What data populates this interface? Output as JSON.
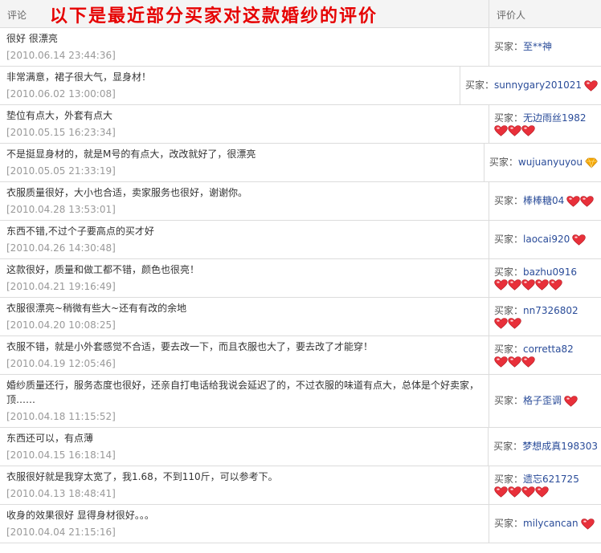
{
  "header": {
    "comment_label": "评论",
    "title": "以下是最近部分买家对这款婚纱的评价",
    "rater_label": "评价人"
  },
  "colors": {
    "title": "#e60000",
    "heart": "#e8303a",
    "diamond": "#f5a700",
    "name": "#2a4c99"
  },
  "reviews": [
    {
      "comment": "很好 很漂亮",
      "date": "[2010.06.14 23:44:36]",
      "buyer_prefix": "买家：",
      "buyer": "至**神",
      "badge": "none",
      "badge_count": 0
    },
    {
      "comment": "非常满意，裙子很大气，显身材！",
      "date": "[2010.06.02 13:00:08]",
      "buyer_prefix": "买家：",
      "buyer": "sunnygary201021",
      "badge": "heart",
      "badge_count": 1
    },
    {
      "comment": "垫位有点大，外套有点大",
      "date": "[2010.05.15 16:23:34]",
      "buyer_prefix": "买家：",
      "buyer": "无边雨丝1982",
      "badge": "heart",
      "badge_count": 3
    },
    {
      "comment": "不是挺显身材的，就是M号的有点大，改改就好了，很漂亮",
      "date": "[2010.05.05 21:33:19]",
      "buyer_prefix": "买家：",
      "buyer": "wujuanyuyou",
      "badge": "diamond",
      "badge_count": 1
    },
    {
      "comment": "衣服质量很好，大小也合适，卖家服务也很好，谢谢你。",
      "date": "[2010.04.28 13:53:01]",
      "buyer_prefix": "买家：",
      "buyer": "棒棒糖04",
      "badge": "heart",
      "badge_count": 2
    },
    {
      "comment": "东西不错,不过个子要高点的买才好",
      "date": "[2010.04.26 14:30:48]",
      "buyer_prefix": "买家：",
      "buyer": "laocai920",
      "badge": "heart",
      "badge_count": 1
    },
    {
      "comment": "这款很好，质量和做工都不错，颜色也很亮！",
      "date": "[2010.04.21 19:16:49]",
      "buyer_prefix": "买家：",
      "buyer": "bazhu0916",
      "badge": "heart",
      "badge_count": 5
    },
    {
      "comment": "衣服很漂亮~稍微有些大~还有有改的余地",
      "date": "[2010.04.20 10:08:25]",
      "buyer_prefix": "买家：",
      "buyer": "nn7326802",
      "badge": "heart",
      "badge_count": 2
    },
    {
      "comment": "衣服不错，就是小外套感觉不合适，要去改一下，而且衣服也大了，要去改了才能穿！",
      "date": "[2010.04.19 12:05:46]",
      "buyer_prefix": "买家：",
      "buyer": "corretta82",
      "badge": "heart",
      "badge_count": 3
    },
    {
      "comment": "婚纱质量还行，服务态度也很好，还亲自打电话给我说会延迟了的，不过衣服的味道有点大，总体是个好卖家，顶……",
      "date": "[2010.04.18 11:15:52]",
      "buyer_prefix": "买家：",
      "buyer": "格子歪调",
      "badge": "heart",
      "badge_count": 1
    },
    {
      "comment": "东西还可以，有点薄",
      "date": "[2010.04.15 16:18:14]",
      "buyer_prefix": "买家：",
      "buyer": "梦想成真198303",
      "badge": "none",
      "badge_count": 0
    },
    {
      "comment": "衣服很好就是我穿太宽了，我1.68，不到110斤，可以参考下。",
      "date": "[2010.04.13 18:48:41]",
      "buyer_prefix": "买家：",
      "buyer": "遗忘621725",
      "badge": "heart",
      "badge_count": 4
    },
    {
      "comment": "收身的效果很好 显得身材很好。。。",
      "date": "[2010.04.04 21:15:16]",
      "buyer_prefix": "买家：",
      "buyer": "milycancan",
      "badge": "heart",
      "badge_count": 1
    }
  ]
}
